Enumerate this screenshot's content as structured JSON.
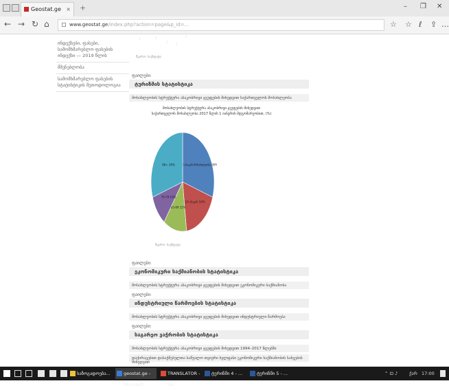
{
  "browser": {
    "tab": {
      "title": "Geostat.ge",
      "close": "×"
    },
    "new_tab": "+",
    "window": {
      "minimize": "–",
      "restore": "❐",
      "close": "✕"
    },
    "nav": {
      "back": "←",
      "forward": "→",
      "refresh": "↻",
      "home": "⌂"
    },
    "url": {
      "domain": "www.geostat.ge",
      "path": "/index.php?action=page&p_id=..."
    },
    "tools": {
      "reader": "☆",
      "favorites": "☆",
      "hub": "ℓ",
      "share": "⇪",
      "more": "…"
    }
  },
  "sidebar": {
    "items": [
      {
        "label": "ინდექსები, ფასები, სამომხმარებლო ფასების ინდექსი — 2019 წლის"
      },
      {
        "label": "მშენებლობა"
      },
      {
        "label": "სამომხმარებლო ფასების სტატისტიკის მეთოდოლოგია"
      }
    ]
  },
  "prev_chart": {
    "ticks": [
      "...",
      "...",
      "...",
      "...",
      "..."
    ],
    "caption": "წყარო: საქსტატი"
  },
  "sections": [
    {
      "label": "ფაილები:",
      "title": "ტურიზმის სტატისტიკა"
    },
    {
      "label": "ფაილები:",
      "title": "ეკონომიკური საქმიანობის სტატისტიკა"
    },
    {
      "label": "ფაილები:",
      "title": "ინდუსტრიული წარმოების სტატისტიკა"
    },
    {
      "label": "ფაილები:",
      "title": "საგარეო ვაჭრობის სტატისტიკა"
    }
  ],
  "descs": [
    "მოსახლეობის სტრუქტურა ასაკობრივი ჯგუფების მიხედვით საქართველოს მოსახლეობა",
    "მოსახლეობის სტრუქტურა ასაკობრივი ჯგუფების მიხედვით ეკონომიკური საქმიანობა",
    "მოსახლეობის სტრუქტურა ასაკობრივი ჯგუფების მიხედვით ინდუსტრიული წარმოება",
    "მოსახლეობის სტრუქტურა ასაკობრივი ჯგუფების მიხედვით 1994–2017 წლებში",
    "დაქირავებით დასაქმებულთა საშუალო თვიური ხელფასი ეკონომიკური საქმიანობის სახეების მიხედვით"
  ],
  "chart_data": {
    "type": "pie",
    "title": "მოსახლეობის სტრუქტურა ასაკობრივი ჯგუფების მიხედვით",
    "subtitle": "საქართველოს მოსახლეობა 2017 წლის 1 იანვრის მდგომარეობით, (%)",
    "source": "წყარო: საქსტატი",
    "categories": [
      "15-64",
      "0-14",
      "65-69",
      "70-79",
      "80+"
    ],
    "values": [
      30,
      18,
      12,
      10,
      30
    ],
    "slice_labels": [
      "15-64 ასაკის მოსახლეობა 30%",
      "0-14 ასაკის 18%",
      "65-69 12%",
      "70-79 10%",
      "80+ 30%"
    ],
    "colors": [
      "#4f81bd",
      "#c0504d",
      "#9bbb59",
      "#8064a2",
      "#4bacc6"
    ]
  },
  "taskbar": {
    "apps": [
      {
        "label": "საზოგადოება..."
      },
      {
        "label": "geostat.ge - Microsoft..."
      },
      {
        "label": "TRANSLATOR - Go..."
      },
      {
        "label": "ტურიზმი 4 - ..."
      },
      {
        "label": "ტურიზმი 5 - ..."
      }
    ],
    "tray": {
      "lang": "ქარ",
      "time": "17:00"
    }
  }
}
